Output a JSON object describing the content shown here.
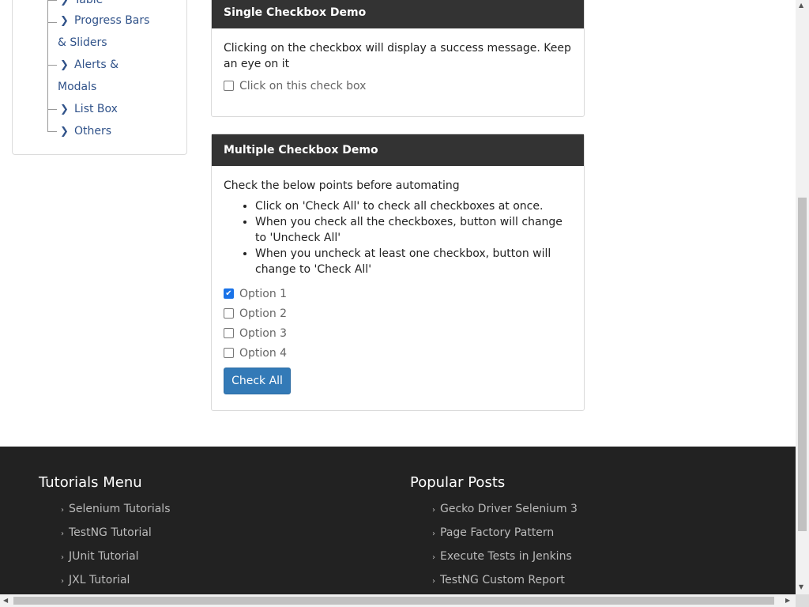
{
  "sidebar": {
    "items": [
      {
        "label": "Table"
      },
      {
        "label": "Progress Bars",
        "cont": "& Sliders"
      },
      {
        "label": "Alerts &",
        "cont": "Modals"
      },
      {
        "label": "List Box"
      },
      {
        "label": "Others"
      }
    ]
  },
  "single": {
    "title": "Single Checkbox Demo",
    "description": "Clicking on the checkbox will display a success message. Keep an eye on it",
    "checkbox_label": "Click on this check box"
  },
  "multiple": {
    "title": "Multiple Checkbox Demo",
    "intro": "Check the below points before automating",
    "points": [
      "Click on 'Check All' to check all checkboxes at once.",
      "When you check all the checkboxes, button will change to 'Uncheck All'",
      "When you uncheck at least one checkbox, button will change to 'Check All'"
    ],
    "options": [
      {
        "label": "Option 1",
        "checked": "true"
      },
      {
        "label": "Option 2",
        "checked": "false"
      },
      {
        "label": "Option 3",
        "checked": "false"
      },
      {
        "label": "Option 4",
        "checked": "false"
      }
    ],
    "button_label": "Check All"
  },
  "footer": {
    "tutorials_title": "Tutorials Menu",
    "tutorials": [
      "Selenium Tutorials",
      "TestNG Tutorial",
      "JUnit Tutorial",
      "JXL Tutorial"
    ],
    "posts_title": "Popular Posts",
    "posts": [
      "Gecko Driver Selenium 3",
      "Page Factory Pattern",
      "Execute Tests in Jenkins",
      "TestNG Custom Report"
    ]
  },
  "colors": {
    "panel_header": "#333333",
    "link": "#31538a",
    "button": "#337ab7",
    "footer_bg": "#222222"
  }
}
